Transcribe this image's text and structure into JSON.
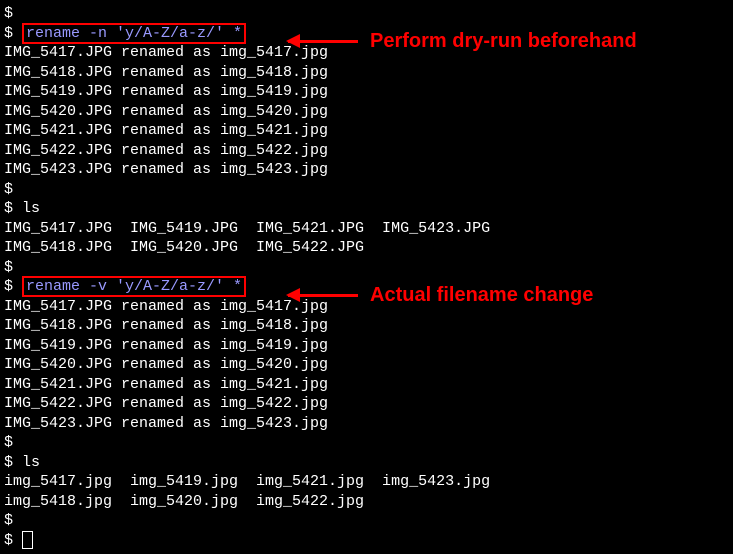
{
  "annotations": {
    "dryrun": "Perform dry-run beforehand",
    "actual": "Actual filename change"
  },
  "lines": {
    "p0": "$",
    "p1": "$ ",
    "cmd1": "rename -n 'y/A-Z/a-z/' *",
    "r1": "IMG_5417.JPG renamed as img_5417.jpg",
    "r2": "IMG_5418.JPG renamed as img_5418.jpg",
    "r3": "IMG_5419.JPG renamed as img_5419.jpg",
    "r4": "IMG_5420.JPG renamed as img_5420.jpg",
    "r5": "IMG_5421.JPG renamed as img_5421.jpg",
    "r6": "IMG_5422.JPG renamed as img_5422.jpg",
    "r7": "IMG_5423.JPG renamed as img_5423.jpg",
    "p2": "$",
    "p3": "$ ls",
    "ls1a": "IMG_5417.JPG  IMG_5419.JPG  IMG_5421.JPG  IMG_5423.JPG",
    "ls1b": "IMG_5418.JPG  IMG_5420.JPG  IMG_5422.JPG",
    "p4": "$",
    "p5": "$ ",
    "cmd2": "rename -v 'y/A-Z/a-z/' *",
    "r8": "IMG_5417.JPG renamed as img_5417.jpg",
    "r9": "IMG_5418.JPG renamed as img_5418.jpg",
    "r10": "IMG_5419.JPG renamed as img_5419.jpg",
    "r11": "IMG_5420.JPG renamed as img_5420.jpg",
    "r12": "IMG_5421.JPG renamed as img_5421.jpg",
    "r13": "IMG_5422.JPG renamed as img_5422.jpg",
    "r14": "IMG_5423.JPG renamed as img_5423.jpg",
    "p6": "$",
    "p7": "$ ls",
    "ls2a": "img_5417.jpg  img_5419.jpg  img_5421.jpg  img_5423.jpg",
    "ls2b": "img_5418.jpg  img_5420.jpg  img_5422.jpg",
    "p8": "$",
    "p9": "$ "
  }
}
